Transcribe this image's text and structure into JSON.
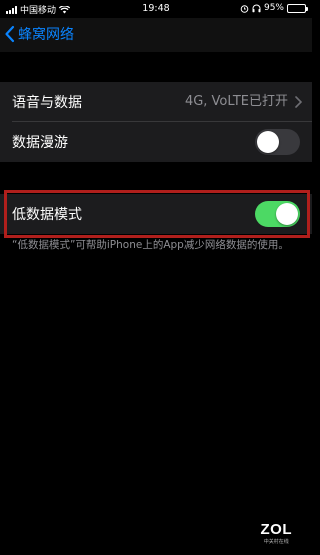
{
  "status_bar": {
    "carrier": "中国移动",
    "time": "19:48",
    "battery_percent": "95%",
    "battery_level": 0.95,
    "icons": [
      "signal-icon",
      "wifi-icon",
      "alarm-icon",
      "headphones-icon",
      "battery-icon"
    ]
  },
  "nav": {
    "back_label": "蜂窝网络"
  },
  "settings": {
    "voice_data": {
      "label": "语音与数据",
      "value": "4G, VoLTE已打开"
    },
    "data_roaming": {
      "label": "数据漫游",
      "on": false
    },
    "low_data_mode": {
      "label": "低数据模式",
      "on": true
    }
  },
  "footer_note": "“低数据模式”可帮助iPhone上的App减少网络数据的使用。",
  "watermark": {
    "logo": "ZOL",
    "sub": "中关村在线"
  },
  "colors": {
    "accent": "#0a84ff",
    "switch_on": "#4cd964",
    "highlight_border": "#b01f1c"
  }
}
